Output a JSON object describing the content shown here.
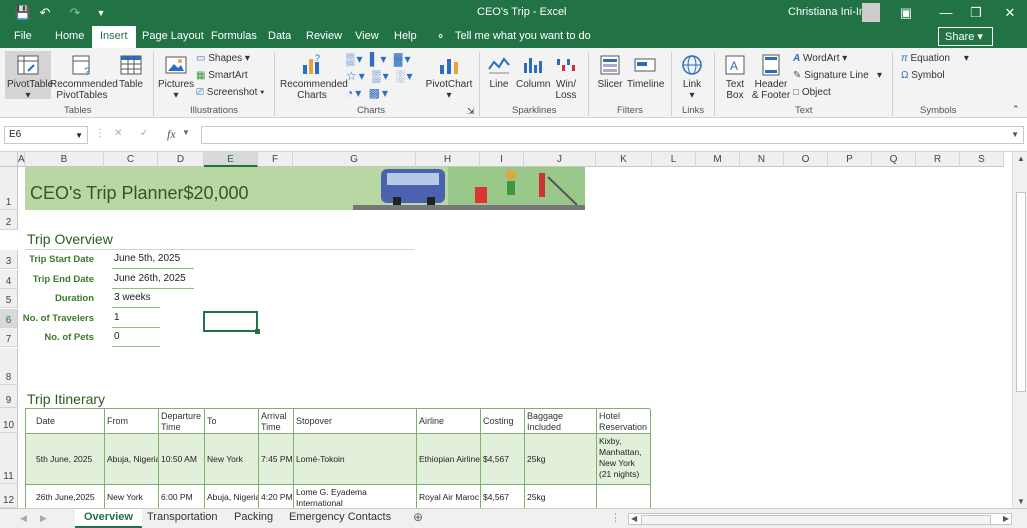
{
  "window": {
    "title": "CEO's Trip  -  Excel",
    "user": "Christiana Ini-Ima"
  },
  "tabs": [
    "File",
    "Home",
    "Insert",
    "Page Layout",
    "Formulas",
    "Data",
    "Review",
    "View",
    "Help"
  ],
  "active_tab": "Insert",
  "tell_me": "Tell me what you want to do",
  "share_label": "Share",
  "ribbon": {
    "pivottable": "PivotTable",
    "recommended_pivot_1": "Recommended",
    "recommended_pivot_2": "PivotTables",
    "table": "Table",
    "pictures": "Pictures",
    "shapes": "Shapes",
    "smartart": "SmartArt",
    "screenshot": "Screenshot",
    "rec_charts_1": "Recommended",
    "rec_charts_2": "Charts",
    "pivotchart": "PivotChart",
    "line": "Line",
    "column": "Column",
    "winloss_1": "Win/",
    "winloss_2": "Loss",
    "slicer": "Slicer",
    "timeline": "Timeline",
    "link": "Link",
    "textbox_1": "Text",
    "textbox_2": "Box",
    "header_1": "Header",
    "header_2": "& Footer",
    "wordart": "WordArt",
    "signature": "Signature Line",
    "object": "Object",
    "equation": "Equation",
    "symbol": "Symbol",
    "groups": {
      "tables": "Tables",
      "illustrations": "Illustrations",
      "charts": "Charts",
      "sparklines": "Sparklines",
      "filters": "Filters",
      "links": "Links",
      "text": "Text",
      "symbols": "Symbols"
    }
  },
  "namebox": "E6",
  "columns": [
    "A",
    "B",
    "C",
    "D",
    "E",
    "F",
    "G",
    "H",
    "I",
    "J",
    "K",
    "L",
    "M",
    "N",
    "O",
    "P",
    "Q",
    "R",
    "S"
  ],
  "rows": [
    "1",
    "2",
    "3",
    "4",
    "5",
    "6",
    "7",
    "8",
    "9",
    "10",
    "11",
    "12"
  ],
  "banner": {
    "title": "CEO's Trip Planner",
    "budget": "$20,000"
  },
  "overview_title": "Trip Overview",
  "overview": [
    {
      "label": "Trip Start Date",
      "value": "June 5th, 2025"
    },
    {
      "label": "Trip End Date",
      "value": "June 26th, 2025"
    },
    {
      "label": "Duration",
      "value": "3 weeks"
    },
    {
      "label": "No. of Travelers",
      "value": "1"
    },
    {
      "label": "No. of Pets",
      "value": "0"
    }
  ],
  "itinerary_title": "Trip Itinerary",
  "itinerary": {
    "headers": [
      "Date",
      "From",
      "Departure Time",
      "To",
      "Arrival Time",
      "Stopover",
      "Airline",
      "Costing",
      "Baggage Included",
      "Hotel Reservation"
    ],
    "rows": [
      [
        "5th June, 2025",
        "Abuja, Nigeria",
        "10:50 AM",
        "New York",
        "7:45 PM",
        "Lomé-Tokoin",
        "Ethiopian Airlines",
        "$4,567",
        "25kg",
        "Kixby, Manhattan, New York (21 nights)"
      ],
      [
        "26th June,2025",
        "New York",
        "6:00 PM",
        "Abuja, Nigeria",
        "4:20 PM",
        "Lome G. Eyadema International",
        "Royal Air Maroc",
        "$4,567",
        "25kg",
        ""
      ]
    ]
  },
  "sheets": [
    "Overview",
    "Transportation",
    "Packing",
    "Emergency Contacts"
  ],
  "active_sheet": "Overview",
  "colors": {
    "excel_green": "#217346",
    "banner_green": "#b9d7a3",
    "label_green": "#3c7a2a"
  }
}
